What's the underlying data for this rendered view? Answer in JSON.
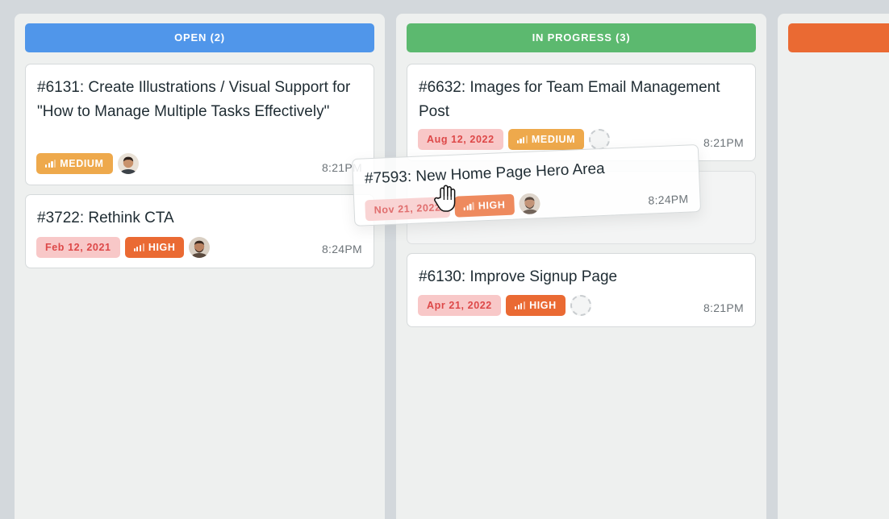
{
  "columns": [
    {
      "header": "OPEN (2)",
      "color": "#5096ea",
      "cards": [
        {
          "title": "#6131: Create Illustrations / Visual Support for \"How to Manage Multiple Tasks Effectively\"",
          "priority": "MEDIUM",
          "time": "8:21PM",
          "avatar": "avatar-man-dark-hair"
        },
        {
          "title": "#3722: Rethink CTA",
          "date": "Feb 12, 2021",
          "priority": "HIGH",
          "time": "8:24PM",
          "avatar": "avatar-man-beard"
        }
      ]
    },
    {
      "header": "IN PROGRESS (3)",
      "color": "#5cb96f",
      "cards": [
        {
          "title": "#6632: Images for Team Email Management Post",
          "date": "Aug 12, 2022",
          "priority": "MEDIUM",
          "time": "8:21PM",
          "avatar": "empty-avatar"
        },
        {
          "title": "#6130: Improve Signup Page",
          "date": "Apr 21, 2022",
          "priority": "HIGH",
          "time": "8:21PM",
          "avatar": "empty-avatar"
        }
      ]
    },
    {
      "header": "",
      "color": "#ea6a33"
    }
  ],
  "dragging_card": {
    "title": "#7593: New Home Page Hero Area",
    "date": "Nov 21, 2022",
    "priority": "HIGH",
    "time": "8:24PM",
    "avatar": "avatar-man-beard"
  },
  "cursor_icon": "grab-hand-icon",
  "priority_colors": {
    "MEDIUM": "#eea94c",
    "HIGH": "#ea6a33"
  },
  "date_chip_color": "#f8c8c8"
}
